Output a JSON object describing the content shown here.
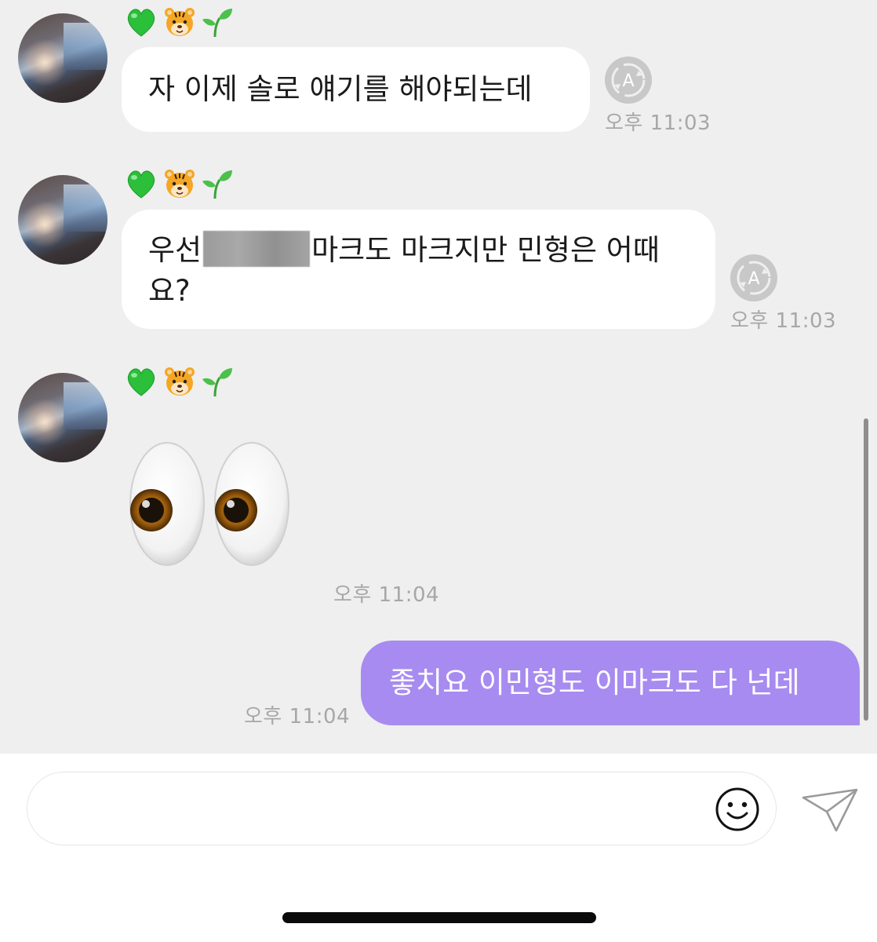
{
  "messages": [
    {
      "sender": "received",
      "badges": [
        "green-heart",
        "tiger",
        "seedling"
      ],
      "text": "자 이제 솔로 얘기를 해야되는데",
      "time": "오후 11:03",
      "translate_icon_label": "A"
    },
    {
      "sender": "received",
      "badges": [
        "green-heart",
        "tiger",
        "seedling"
      ],
      "text_before": "우선",
      "text_after": "마크도 마크지만 민형은 어때",
      "text_line2": "요?",
      "time": "오후 11:03",
      "translate_icon_label": "A"
    },
    {
      "sender": "received",
      "badges": [
        "green-heart",
        "tiger",
        "seedling"
      ],
      "emoji": "eyes",
      "time": "오후 11:04"
    },
    {
      "sender": "sent",
      "text": "좋치요 이민형도 이마크도 다 넌데",
      "time": "오후 11:04"
    }
  ],
  "composer": {
    "value": "",
    "emoji_icon": "smiley-icon",
    "send_icon": "paper-plane-icon"
  },
  "colors": {
    "chat_background": "#efefef",
    "sent_bubble": "#a78bf0",
    "received_bubble": "#ffffff",
    "timestamp": "#a7a7a7"
  }
}
